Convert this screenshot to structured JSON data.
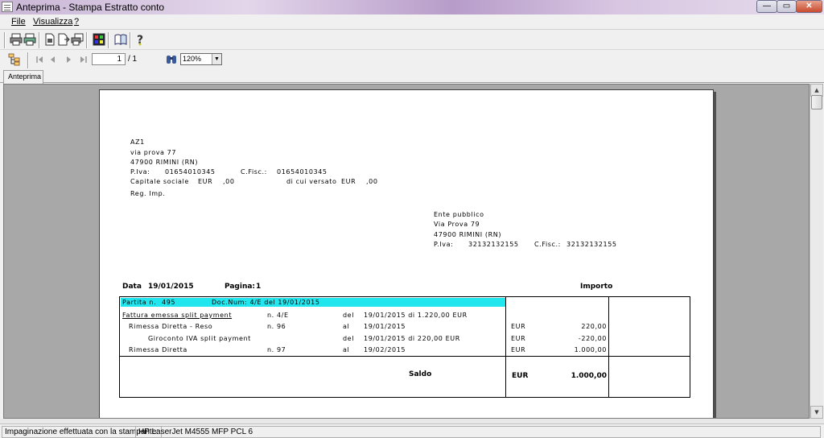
{
  "window": {
    "title": "Anteprima - Stampa Estratto conto",
    "min": "—",
    "max": "▭",
    "close": "✕"
  },
  "menu": {
    "file": "File",
    "view": "Visualizza",
    "help": "?"
  },
  "nav": {
    "page_value": "1",
    "page_total": "/ 1",
    "zoom_value": "120%"
  },
  "tabs": {
    "preview": "Anteprima"
  },
  "doc": {
    "company": {
      "name": "AZ1",
      "address": "via prova 77",
      "city": "47900 RIMINI (RN)",
      "piva_label": "P.Iva:",
      "piva": "01654010345",
      "cf_label": "C.Fisc.:",
      "cf": "01654010345",
      "capital_label": "Capitale sociale",
      "capital_cur": "EUR",
      "capital_val": ",00",
      "paid_label": "di cui versato",
      "paid_cur": "EUR",
      "paid_val": ",00",
      "reg": "Reg. Imp."
    },
    "recipient": {
      "name": "Ente pubblico",
      "address": "Via Prova 79",
      "city": "47900 RIMINI (RN)",
      "piva_label": "P.Iva:",
      "piva": "32132132155",
      "cf_label": "C.Fisc.:",
      "cf": "32132132155"
    },
    "header": {
      "date_label": "Data",
      "date": "19/01/2015",
      "page_label": "Pagina:",
      "page": "1",
      "amount_label": "Importo"
    },
    "partita": {
      "label": "Partita n.",
      "num": "495",
      "doc": "Doc.Num: 4/E del 19/01/2015"
    },
    "rows": [
      {
        "desc": "Fattura emessa split payment",
        "num": "n. 4/E",
        "prep": "del",
        "date": "19/01/2015 di  1.220,00 EUR",
        "cur": "",
        "amount": ""
      },
      {
        "desc": "Rimessa Diretta - Reso",
        "num": "n. 96",
        "prep": "al",
        "date": "19/01/2015",
        "cur": "EUR",
        "amount": "220,00"
      },
      {
        "desc": "Giroconto IVA split payment",
        "num": "",
        "prep": "del",
        "date": "19/01/2015 di  220,00 EUR",
        "cur": "EUR",
        "amount": "-220,00"
      },
      {
        "desc": "Rimessa Diretta",
        "num": "n. 97",
        "prep": "al",
        "date": "19/02/2015",
        "cur": "EUR",
        "amount": "1.000,00"
      }
    ],
    "total": {
      "label": "Saldo",
      "cur": "EUR",
      "amount": "1.000,00"
    }
  },
  "status": {
    "label": "Impaginazione effettuata con la stampante:",
    "printer": "HP LaserJet M4555 MFP PCL 6"
  },
  "colors": {
    "highlight": "#22e6ee",
    "viewport": "#a8a8a8"
  }
}
